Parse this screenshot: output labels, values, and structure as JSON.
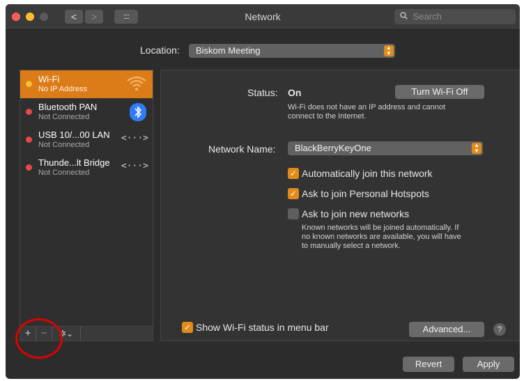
{
  "window": {
    "title": "Network",
    "search_placeholder": "Search",
    "nav_back": "<",
    "nav_forward": ">",
    "grid": "::::"
  },
  "location": {
    "label": "Location:",
    "value": "Biskom Meeting"
  },
  "services": [
    {
      "name": "Wi-Fi",
      "status": "No IP Address",
      "dot_color": "#f5c12e",
      "icon": "wifi-icon",
      "selected": true
    },
    {
      "name": "Bluetooth PAN",
      "status": "Not Connected",
      "dot_color": "#e84848",
      "icon": "bluetooth-icon",
      "selected": false
    },
    {
      "name": "USB 10/...00 LAN",
      "status": "Not Connected",
      "dot_color": "#e84848",
      "icon": "ethernet-arrows-icon",
      "selected": false
    },
    {
      "name": "Thunde...lt Bridge",
      "status": "Not Connected",
      "dot_color": "#e84848",
      "icon": "ethernet-arrows-icon",
      "selected": false
    }
  ],
  "sidebar_buttons": {
    "add": "+",
    "remove": "−",
    "action": "✲⌄"
  },
  "detail": {
    "status_label": "Status:",
    "status_value": "On",
    "turn_off_button": "Turn Wi-Fi Off",
    "status_description_line1": "Wi-Fi does not have an IP address and cannot",
    "status_description_line2": "connect to the Internet.",
    "network_name_label": "Network Name:",
    "network_name_value": "BlackBerryKeyOne",
    "auto_join_label": "Automatically join this network",
    "auto_join_checked": true,
    "hotspots_label": "Ask to join Personal Hotspots",
    "hotspots_checked": true,
    "new_networks_label": "Ask to join new networks",
    "new_networks_checked": false,
    "new_networks_help_line1": "Known networks will be joined automatically. If",
    "new_networks_help_line2": "no known networks are available, you will have",
    "new_networks_help_line3": "to manually select a network.",
    "show_status_label": "Show Wi-Fi status in menu bar",
    "show_status_checked": true,
    "advanced_button": "Advanced...",
    "help_button": "?"
  },
  "footer": {
    "revert": "Revert",
    "apply": "Apply"
  },
  "colors": {
    "accent": "#e28a1a",
    "selected_row": "#dc7c18",
    "window_bg": "#2c2c2c",
    "annotation_circle": "#e00000"
  }
}
